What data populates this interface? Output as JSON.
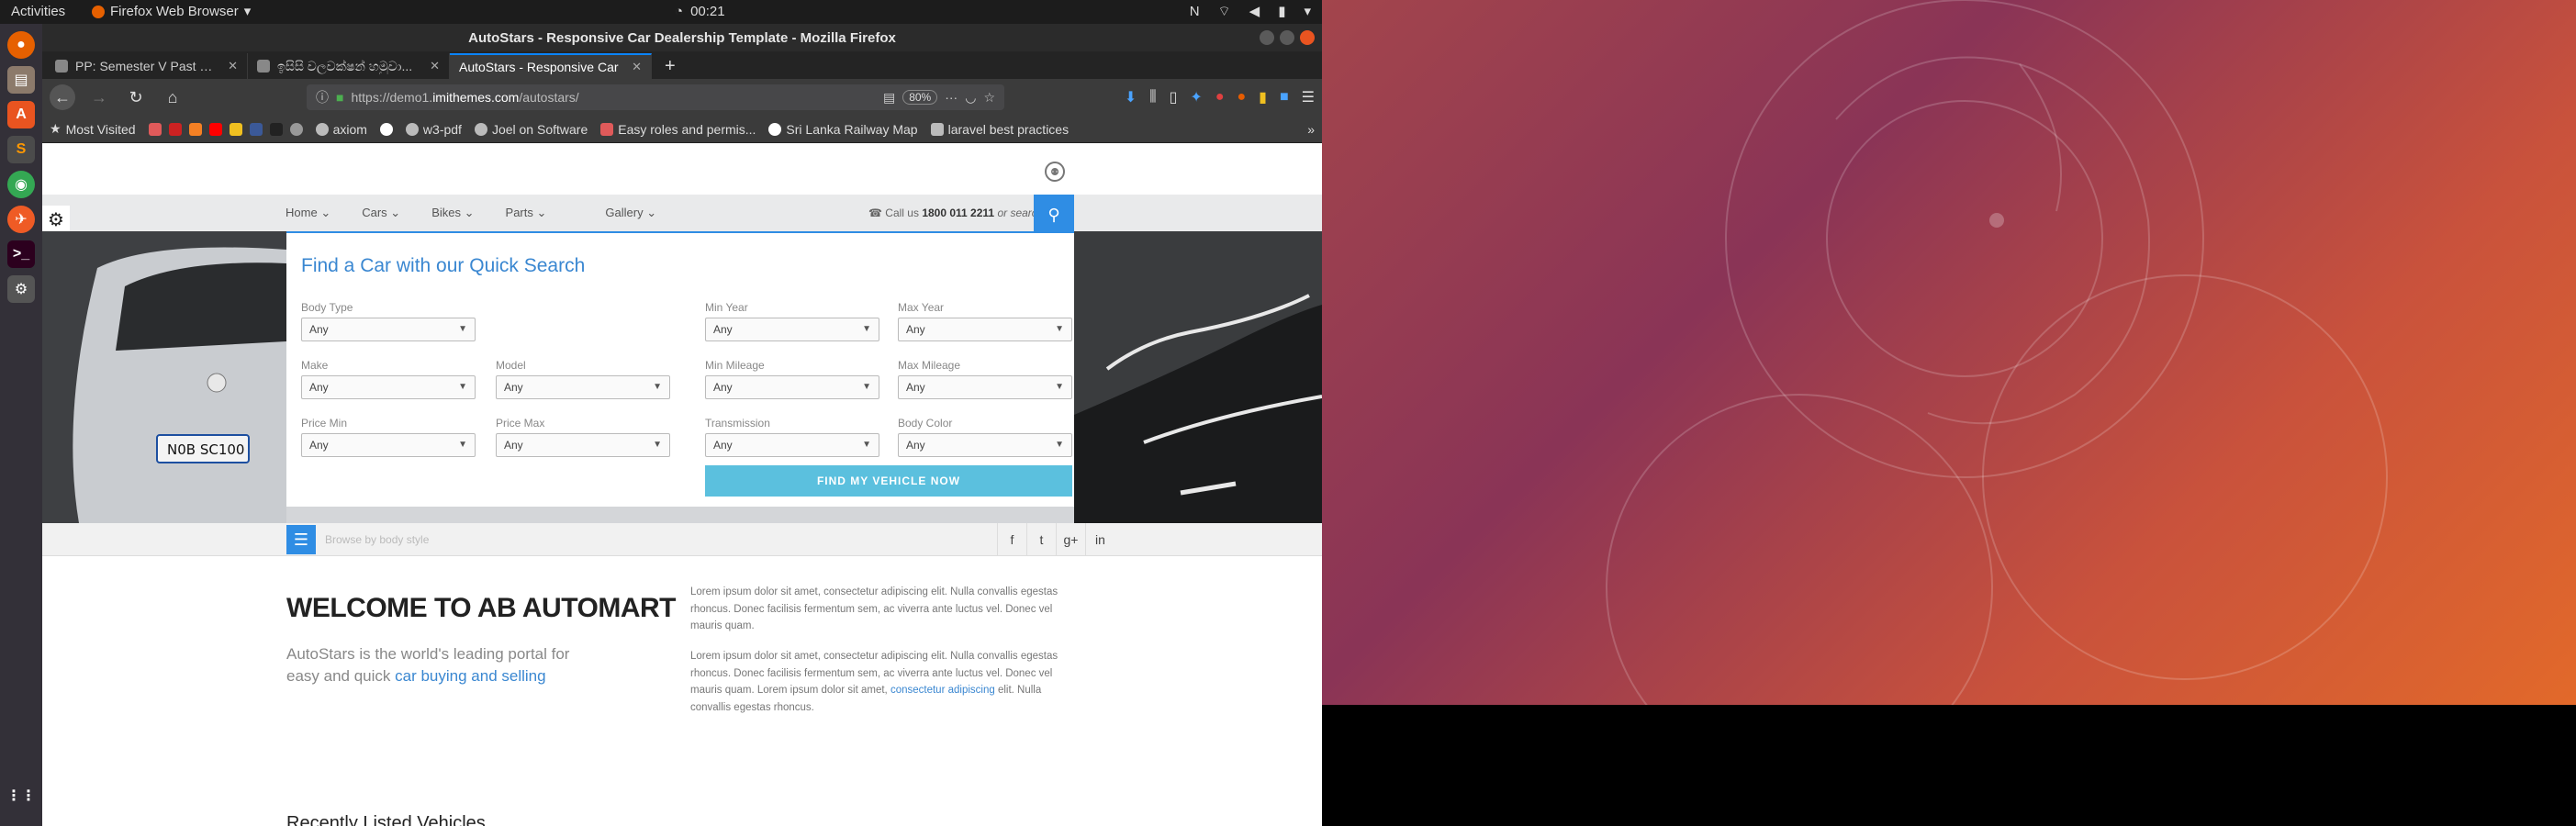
{
  "topbar": {
    "activities": "Activities",
    "app_name": "Firefox Web Browser",
    "time": "00:21"
  },
  "window": {
    "title": "AutoStars - Responsive Car Dealership Template - Mozilla Firefox"
  },
  "tabs": [
    {
      "label": "PP: Semester V Past Pap",
      "active": false
    },
    {
      "label": "ඉසිසි වලවක්ෂන් හමුවා...",
      "active": false
    },
    {
      "label": "AutoStars - Responsive Car",
      "active": true
    }
  ],
  "url": {
    "prefix": "https://demo1.",
    "domain": "imithemes.com",
    "path": "/autostars/",
    "zoom": "80%"
  },
  "bookmarks": [
    {
      "label": "Most Visited",
      "color": "#cccccc"
    },
    {
      "label": "axiom",
      "color": "#bbbbbb"
    },
    {
      "label": "w3-pdf",
      "color": "#bbbbbb"
    },
    {
      "label": "Joel on Software",
      "color": "#bbbbbb"
    },
    {
      "label": "Easy roles and permis...",
      "color": "#e05a5a"
    },
    {
      "label": "Sri Lanka Railway Map",
      "color": "#bbbbbb"
    },
    {
      "label": "laravel best practices",
      "color": "#bbbbbb"
    }
  ],
  "site": {
    "nav": [
      "Home",
      "Cars",
      "Bikes",
      "Parts",
      "Gallery"
    ],
    "callus_prefix": "Call us",
    "phone": "1800 011 2211",
    "callus_suffix": "or search",
    "quick_search_title": "Find a Car with our Quick Search",
    "fields": {
      "body_type": {
        "label": "Body Type",
        "value": "Any"
      },
      "min_year": {
        "label": "Min Year",
        "value": "Any"
      },
      "max_year": {
        "label": "Max Year",
        "value": "Any"
      },
      "make": {
        "label": "Make",
        "value": "Any"
      },
      "model": {
        "label": "Model",
        "value": "Any"
      },
      "min_mileage": {
        "label": "Min Mileage",
        "value": "Any"
      },
      "max_mileage": {
        "label": "Max Mileage",
        "value": "Any"
      },
      "price_min": {
        "label": "Price Min",
        "value": "Any"
      },
      "price_max": {
        "label": "Price Max",
        "value": "Any"
      },
      "transmission": {
        "label": "Transmission",
        "value": "Any"
      },
      "body_color": {
        "label": "Body Color",
        "value": "Any"
      }
    },
    "find_button": "FIND MY VEHICLE NOW",
    "browse_placeholder": "Browse by body style",
    "welcome_title": "WELCOME TO AB AUTOMART",
    "lead_text": "AutoStars is the world's leading portal for easy and quick",
    "lead_link": "car buying and selling",
    "para1": "Lorem ipsum dolor sit amet, consectetur adipiscing elit. Nulla convallis egestas rhoncus. Donec facilisis fermentum sem, ac viverra ante luctus vel. Donec vel mauris quam.",
    "para2_a": "Lorem ipsum dolor sit amet, consectetur adipiscing elit. Nulla convallis egestas rhoncus. Donec facilisis fermentum sem, ac viverra ante luctus vel. Donec vel mauris quam. Lorem ipsum dolor sit amet,",
    "para2_link": "consectetur adipiscing",
    "para2_b": "elit. Nulla convallis egestas rhoncus.",
    "recent_title": "Recently Listed Vehicles"
  },
  "colors": {
    "accent": "#2f8de4",
    "button": "#5bc0de",
    "ubuntu_orange": "#e95420"
  }
}
